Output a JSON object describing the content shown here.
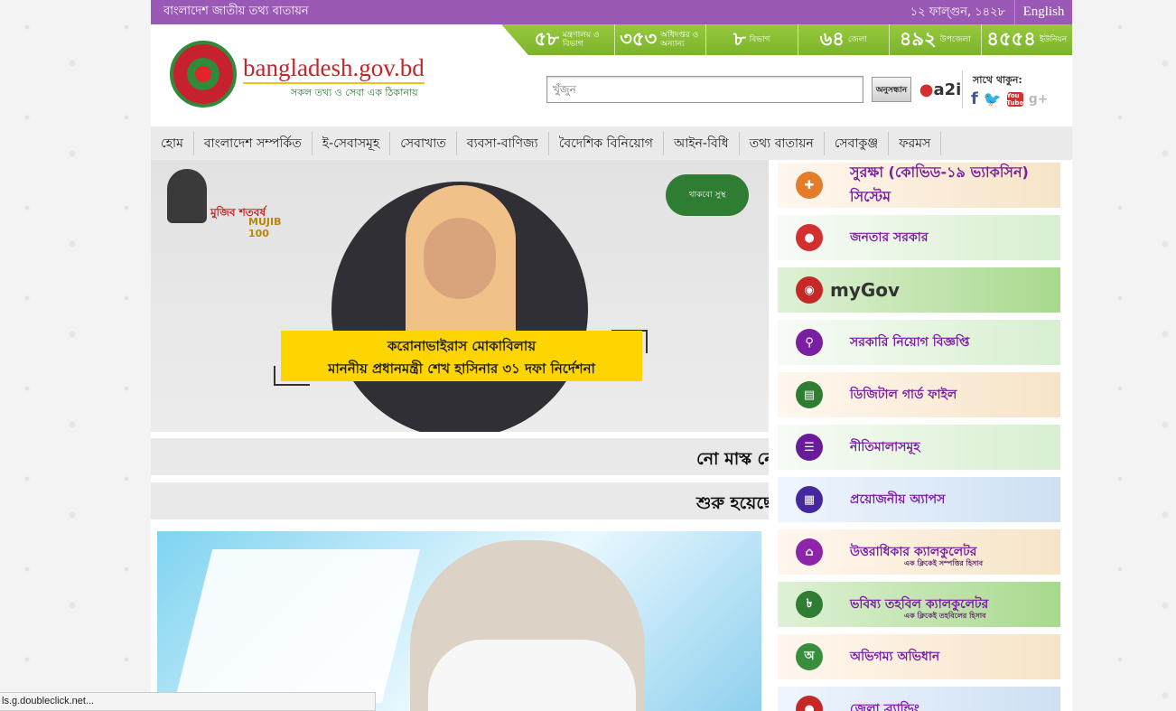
{
  "topbar": {
    "title": "বাংলাদেশ জাতীয় তথ্য বাতায়ন",
    "date": "১২ ফাল্গুন, ১৪২৮",
    "language": "English"
  },
  "stats": [
    {
      "num": "৫৮",
      "label": "মন্ত্রণালয় ও বিভাগ"
    },
    {
      "num": "৩৫৩",
      "label": "অধিদপ্তর ও অন্যান্য"
    },
    {
      "num": "৮",
      "label": "বিভাগ"
    },
    {
      "num": "৬৪",
      "label": "জেলা"
    },
    {
      "num": "৪৯২",
      "label": "উপজেলা"
    },
    {
      "num": "৪৫৫৪",
      "label": "ইউনিয়ন"
    }
  ],
  "header": {
    "site_name": "bangladesh.gov.bd",
    "tagline": "সকল তথ্য ও সেবা এক ঠিকানায়",
    "follow_label": "সাথে থাকুন:",
    "a2i": "a2i"
  },
  "search": {
    "placeholder": "খুঁজুন",
    "button": "অনুসন্ধান"
  },
  "nav": [
    "হোম",
    "বাংলাদেশ সম্পর্কিত",
    "ই-সেবাসমূহ",
    "সেবাখাত",
    "ব্যবসা-বাণিজ্য",
    "বৈদেশিক বিনিয়োগ",
    "আইন-বিধি",
    "তথ্য বাতায়ন",
    "সেবাকুঞ্জ",
    "ফরমস"
  ],
  "banner": {
    "mujib_text": "মুজিব শতবর্ষ",
    "mujib_num": "MUJIB 100",
    "healthy_text": "থাকবো সুস্থ",
    "caption_line1": "করোনাভাইরাস মোকাবিলায়",
    "caption_line2": "মাননীয় প্রধানমন্ত্রী শেখ হাসিনার ৩১ দফা নির্দেশনা"
  },
  "tickers": [
    "নো মাস্ক নো",
    "শুরু হয়েছে"
  ],
  "sidebar": [
    {
      "label": "সুরক্ষা (কোভিড-১৯ ভ্যাকসিন) সিস্টেম",
      "icon": "shield-icon",
      "glyph": "✚",
      "color": "#e57c2a"
    },
    {
      "label": "জনতার সরকার",
      "icon": "map-icon",
      "glyph": "●",
      "color": "#d32f2f"
    },
    {
      "label": "myGov",
      "icon": "mygov-icon",
      "glyph": "◉",
      "color": "#c62828"
    },
    {
      "label": "সরকারি নিয়োগ বিজ্ঞপ্তি",
      "icon": "search-people-icon",
      "glyph": "⚲",
      "color": "#7b1fa2"
    },
    {
      "label": "ডিজিটাল গার্ড ফাইল",
      "icon": "file-icon",
      "glyph": "▤",
      "color": "#2e7d32"
    },
    {
      "label": "নীতিমালাসমূহ",
      "icon": "policy-icon",
      "glyph": "☰",
      "color": "#6a1b9a"
    },
    {
      "label": "প্রয়োজনীয় অ্যাপস",
      "icon": "apps-icon",
      "glyph": "▦",
      "color": "#4527a0"
    },
    {
      "label": "উত্তরাধিকার ক্যালকুলেটর",
      "sub": "এক ক্লিকেই সম্পত্তির হিসাব",
      "icon": "family-icon",
      "glyph": "⌂",
      "color": "#8e24aa"
    },
    {
      "label": "ভবিষ্য তহবিল ক্যালকুলেটর",
      "sub": "এক ক্লিকেই তহবিলের হিসাব",
      "icon": "fund-icon",
      "glyph": "৳",
      "color": "#2e7d32"
    },
    {
      "label": "অভিগম্য অভিধান",
      "icon": "dictionary-icon",
      "glyph": "অ",
      "color": "#388e3c"
    },
    {
      "label": "জেলা ব্র্যান্ডিং",
      "icon": "district-icon",
      "glyph": "●",
      "color": "#c62828"
    }
  ],
  "statusbar": {
    "text": "ls.g.doubleclick.net..."
  }
}
